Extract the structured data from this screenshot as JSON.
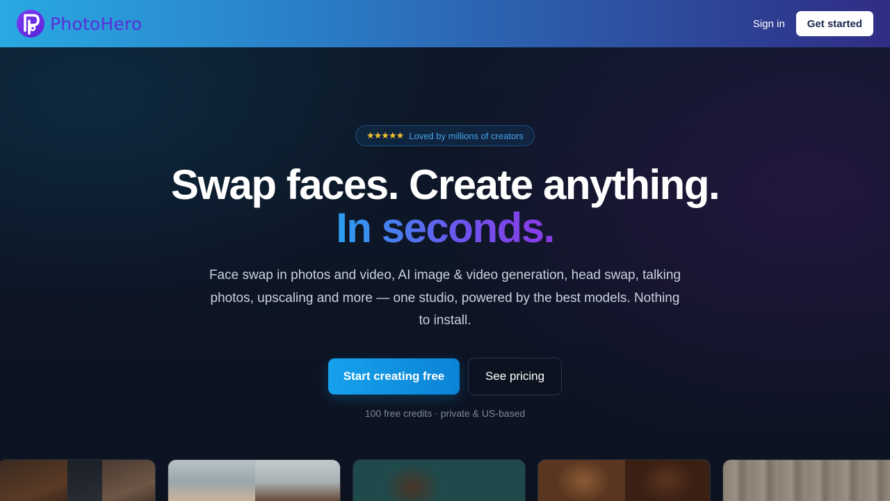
{
  "brand": {
    "name": "PhotoHero",
    "logo_icon": "photohero-logo-icon",
    "logo_color": "#6d35e8"
  },
  "nav": {
    "signin_label": "Sign in",
    "get_started_label": "Get started"
  },
  "hero": {
    "badge": {
      "stars": "★★★★★",
      "text": "Loved by millions of creators"
    },
    "headline_line1": "Swap faces. Create anything.",
    "headline_line2": "In seconds.",
    "subtitle": "Face swap in photos and video, AI image & video generation, head swap, talking photos, upscaling and more — one studio, powered by the best models. Nothing to install.",
    "primary_cta": "Start creating free",
    "secondary_cta": "See pricing",
    "footnote": "100 free credits · private & US-based"
  },
  "colors": {
    "accent_blue": "#1aa1ec",
    "accent_purple": "#7b3fe8",
    "star_yellow": "#f6c232",
    "background": "#0d1626"
  },
  "gallery": [
    {
      "name": "gallery-card-1"
    },
    {
      "name": "gallery-card-2"
    },
    {
      "name": "gallery-card-3"
    },
    {
      "name": "gallery-card-4"
    },
    {
      "name": "gallery-card-5"
    }
  ]
}
